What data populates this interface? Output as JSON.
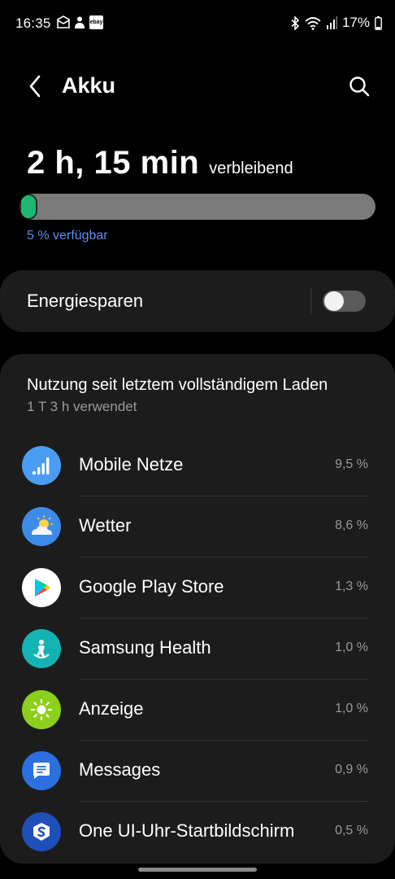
{
  "status_bar": {
    "time": "16:35",
    "battery_percent": "17%",
    "notifications": [
      "mail-check-icon",
      "person-notification-icon",
      "ebay-icon"
    ],
    "ebay_label": "ebay",
    "system_icons": [
      "bluetooth-icon",
      "wifi-icon",
      "signal-icon",
      "battery-icon"
    ]
  },
  "header": {
    "title": "Akku",
    "back_icon": "back-arrow-icon",
    "search_icon": "search-icon"
  },
  "battery": {
    "remaining_time": "2 h, 15 min",
    "remaining_label": "verbleibend",
    "level_percent": 5,
    "available_text": "5 % verfügbar",
    "fill_color": "#1db870",
    "track_color": "#7a7a7a",
    "accent_text_color": "#5d8fef"
  },
  "power_saving": {
    "label": "Energiesparen",
    "enabled": false
  },
  "usage": {
    "title": "Nutzung seit letztem vollständigem Laden",
    "subtitle": "1 T 3 h verwendet",
    "apps": [
      {
        "name": "Mobile Netze",
        "percent": "9,5 %",
        "icon": "mobile-network-icon"
      },
      {
        "name": "Wetter",
        "percent": "8,6 %",
        "icon": "weather-icon"
      },
      {
        "name": "Google Play Store",
        "percent": "1,3 %",
        "icon": "google-play-icon"
      },
      {
        "name": "Samsung Health",
        "percent": "1,0 %",
        "icon": "samsung-health-icon"
      },
      {
        "name": "Anzeige",
        "percent": "1,0 %",
        "icon": "display-brightness-icon"
      },
      {
        "name": "Messages",
        "percent": "0,9 %",
        "icon": "messages-icon"
      },
      {
        "name": "One UI-Uhr-Startbildschirm",
        "percent": "0,5 %",
        "icon": "one-ui-clock-icon"
      }
    ]
  }
}
